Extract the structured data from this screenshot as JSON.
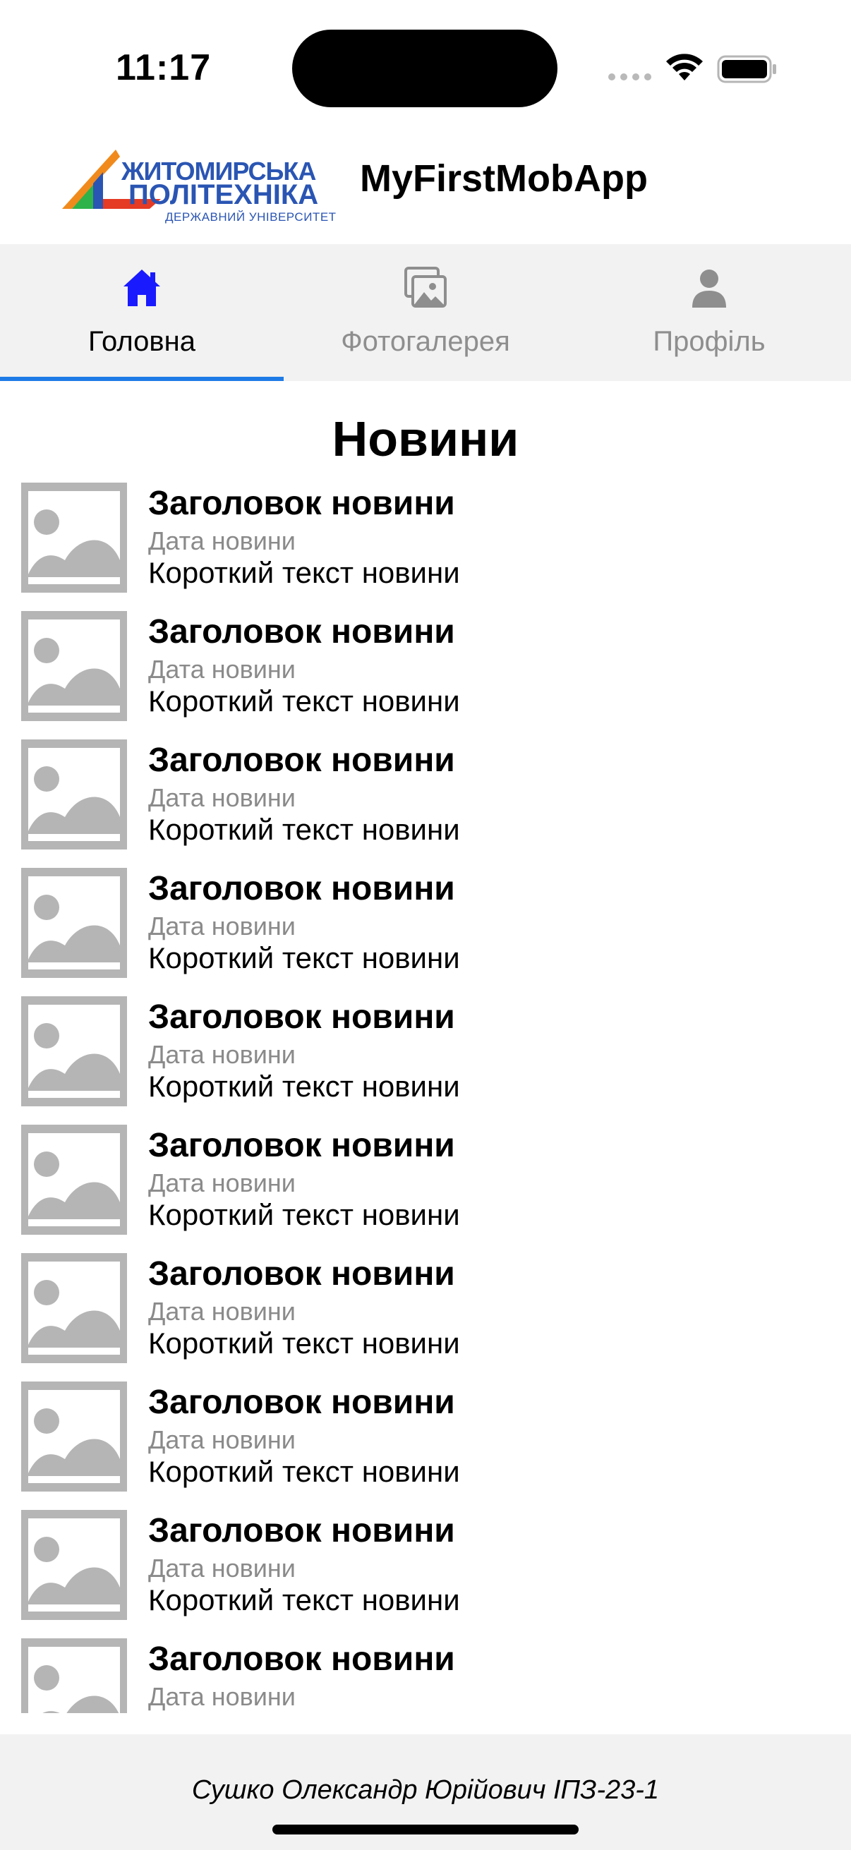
{
  "status_bar": {
    "time": "11:17"
  },
  "header": {
    "logo": {
      "line1": "ЖИТОМИРСЬКА",
      "line2": "ПОЛІТЕХНІКА",
      "line3": "ДЕРЖАВНИЙ УНІВЕРСИТЕТ"
    },
    "title": "MyFirstMobApp"
  },
  "tabs": [
    {
      "label": "Головна",
      "icon": "home-icon",
      "active": true
    },
    {
      "label": "Фотогалерея",
      "icon": "photo-gallery-icon",
      "active": false
    },
    {
      "label": "Профіль",
      "icon": "person-icon",
      "active": false
    }
  ],
  "colors": {
    "tab_active_icon": "#1a1aff",
    "tab_indicator": "#1e7be6",
    "tab_inactive": "#8e8e8e",
    "thumbnail_placeholder": "#b5b5b5",
    "bar_background": "#f2f2f2"
  },
  "main": {
    "section_title": "Новини",
    "news": [
      {
        "title": "Заголовок новини",
        "date": "Дата новини",
        "text": "Короткий текст новини"
      },
      {
        "title": "Заголовок новини",
        "date": "Дата новини",
        "text": "Короткий текст новини"
      },
      {
        "title": "Заголовок новини",
        "date": "Дата новини",
        "text": "Короткий текст новини"
      },
      {
        "title": "Заголовок новини",
        "date": "Дата новини",
        "text": "Короткий текст новини"
      },
      {
        "title": "Заголовок новини",
        "date": "Дата новини",
        "text": "Короткий текст новини"
      },
      {
        "title": "Заголовок новини",
        "date": "Дата новини",
        "text": "Короткий текст новини"
      },
      {
        "title": "Заголовок новини",
        "date": "Дата новини",
        "text": "Короткий текст новини"
      },
      {
        "title": "Заголовок новини",
        "date": "Дата новини",
        "text": "Короткий текст новини"
      },
      {
        "title": "Заголовок новини",
        "date": "Дата новини",
        "text": "Короткий текст новини"
      },
      {
        "title": "Заголовок новини",
        "date": "Дата новини",
        "text": ""
      }
    ]
  },
  "footer": {
    "text": "Сушко Олександр Юрійович ІПЗ-23-1"
  }
}
